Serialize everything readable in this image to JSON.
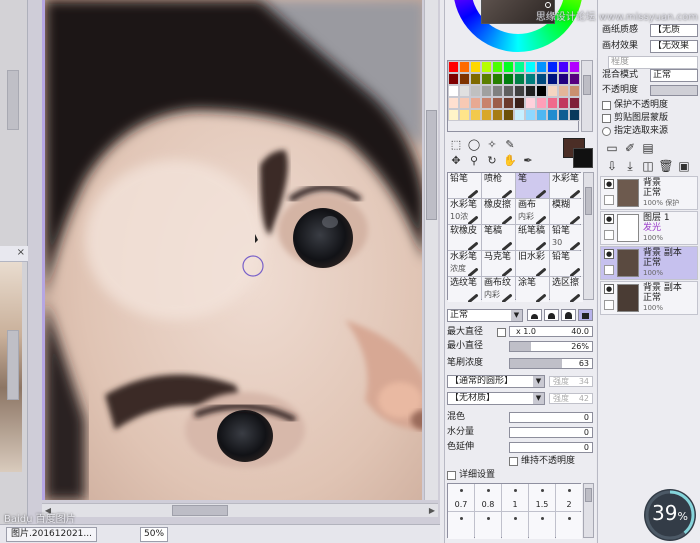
{
  "canvas": {
    "subwindow_close": "×",
    "document_tab": "图片.201612021...",
    "zoom": "50%",
    "overlay_mark": "Baidu 百度图片"
  },
  "palette": {
    "swatches": [
      "#ff0000",
      "#ff6a00",
      "#ffd800",
      "#b6ff00",
      "#4cff00",
      "#00ff21",
      "#00ff90",
      "#00ffff",
      "#0094ff",
      "#0026ff",
      "#4800ff",
      "#b200ff",
      "#7f0000",
      "#7f3300",
      "#7f6a00",
      "#5b7f00",
      "#267f00",
      "#007f0e",
      "#007f46",
      "#007f7f",
      "#004a7f",
      "#00137f",
      "#21007f",
      "#57007f",
      "#ffffff",
      "#e0e0e0",
      "#c0c0c0",
      "#a0a0a0",
      "#808080",
      "#606060",
      "#404040",
      "#202020",
      "#000000",
      "#f4d5c1",
      "#e3b69a",
      "#c98f6e",
      "#ffe0d0",
      "#f7c9b4",
      "#e8a992",
      "#c8826c",
      "#9c5d4a",
      "#6b3a2d",
      "#3a1f18",
      "#ffd1dc",
      "#ff9fb8",
      "#f06a8b",
      "#c1395e",
      "#7f1f38",
      "#fff4c8",
      "#ffe58a",
      "#f2c94c",
      "#d9a72a",
      "#a67c14",
      "#6b4f0a",
      "#c8f0ff",
      "#8fd8ff",
      "#4fb7f2",
      "#1f8ccf",
      "#0f5e93",
      "#083a5c"
    ],
    "foreground": "#4b2e26",
    "background": "#111111"
  },
  "brushes": [
    {
      "label": "铅笔",
      "size": ""
    },
    {
      "label": "喷枪",
      "size": ""
    },
    {
      "label": "笔",
      "size": "",
      "selected": true
    },
    {
      "label": "水彩笔",
      "size": ""
    },
    {
      "label": "水彩笔",
      "size": "10浓"
    },
    {
      "label": "橡皮擦",
      "size": ""
    },
    {
      "label": "画布",
      "size": "内彩"
    },
    {
      "label": "模糊",
      "size": ""
    },
    {
      "label": "软橡皮",
      "size": ""
    },
    {
      "label": "笔稿",
      "size": ""
    },
    {
      "label": "纸笔稿",
      "size": ""
    },
    {
      "label": "铅笔",
      "size": "30"
    },
    {
      "label": "水彩笔",
      "size": "浓度"
    },
    {
      "label": "马克笔",
      "size": ""
    },
    {
      "label": "旧水彩",
      "size": ""
    },
    {
      "label": "铅笔",
      "size": ""
    },
    {
      "label": "选纹笔",
      "size": ""
    },
    {
      "label": "画布纹",
      "size": "内彩"
    },
    {
      "label": "涂笔",
      "size": ""
    },
    {
      "label": "选区擦",
      "size": ""
    }
  ],
  "brush_settings": {
    "blend_mode": "正常",
    "max_size_label": "最大直径",
    "max_size_multiplier": "x 1.0",
    "max_size_value": "40.0",
    "min_size_label": "最小直径",
    "min_size_value": "26%",
    "min_size_fraction": 0.26,
    "density_label": "笔刷浓度",
    "density_value": "63",
    "density_fraction": 0.63,
    "shape": "【通常的圆形】",
    "shape_strength_label": "强度",
    "shape_strength_value": "34",
    "texture": "【无材质】",
    "texture_strength_label": "强度",
    "texture_strength_value": "42",
    "blend_label": "混色",
    "blend_value": "0",
    "water_label": "水分量",
    "water_value": "0",
    "color_extend_label": "色延伸",
    "color_extend_value": "0",
    "keep_opacity_label": "维持不透明度",
    "detail_label": "详细设置",
    "presets": [
      "0.7",
      "0.8",
      "1",
      "1.5",
      "2",
      "",
      "",
      "",
      "",
      ""
    ]
  },
  "layer_panel": {
    "paper_quality_label": "画纸质感",
    "paper_quality_value": "【无质",
    "paper_effect_label": "画材效果",
    "paper_effect_value": "【无效果",
    "degree_label": "程度",
    "blend_mode_label": "混合模式",
    "blend_mode_value": "正常",
    "opacity_label": "不透明度",
    "protect_opacity": "保护不透明度",
    "clip_group": "剪贴图层蒙版",
    "selection_source": "指定选取来源",
    "layers": [
      {
        "name": "背景",
        "mode": "正常",
        "opacity": "100%",
        "note": "保护",
        "thumb": "#6d5a4e",
        "selected": false
      },
      {
        "name": "图层 1",
        "mode": "发光",
        "opacity": "100%",
        "note": "",
        "thumb": "#ffffff",
        "selected": false
      },
      {
        "name": "背景 副本",
        "mode": "正常",
        "opacity": "100%",
        "note": "",
        "thumb": "#5a4a40",
        "selected": true
      },
      {
        "name": "背景 副本",
        "mode": "正常",
        "opacity": "100%",
        "note": "",
        "thumb": "#4a3c34",
        "selected": false
      }
    ]
  },
  "watermark": "思缘设计论坛 www.missyuan.com",
  "progress": {
    "value": "39",
    "unit": "%",
    "fraction": 0.39
  }
}
